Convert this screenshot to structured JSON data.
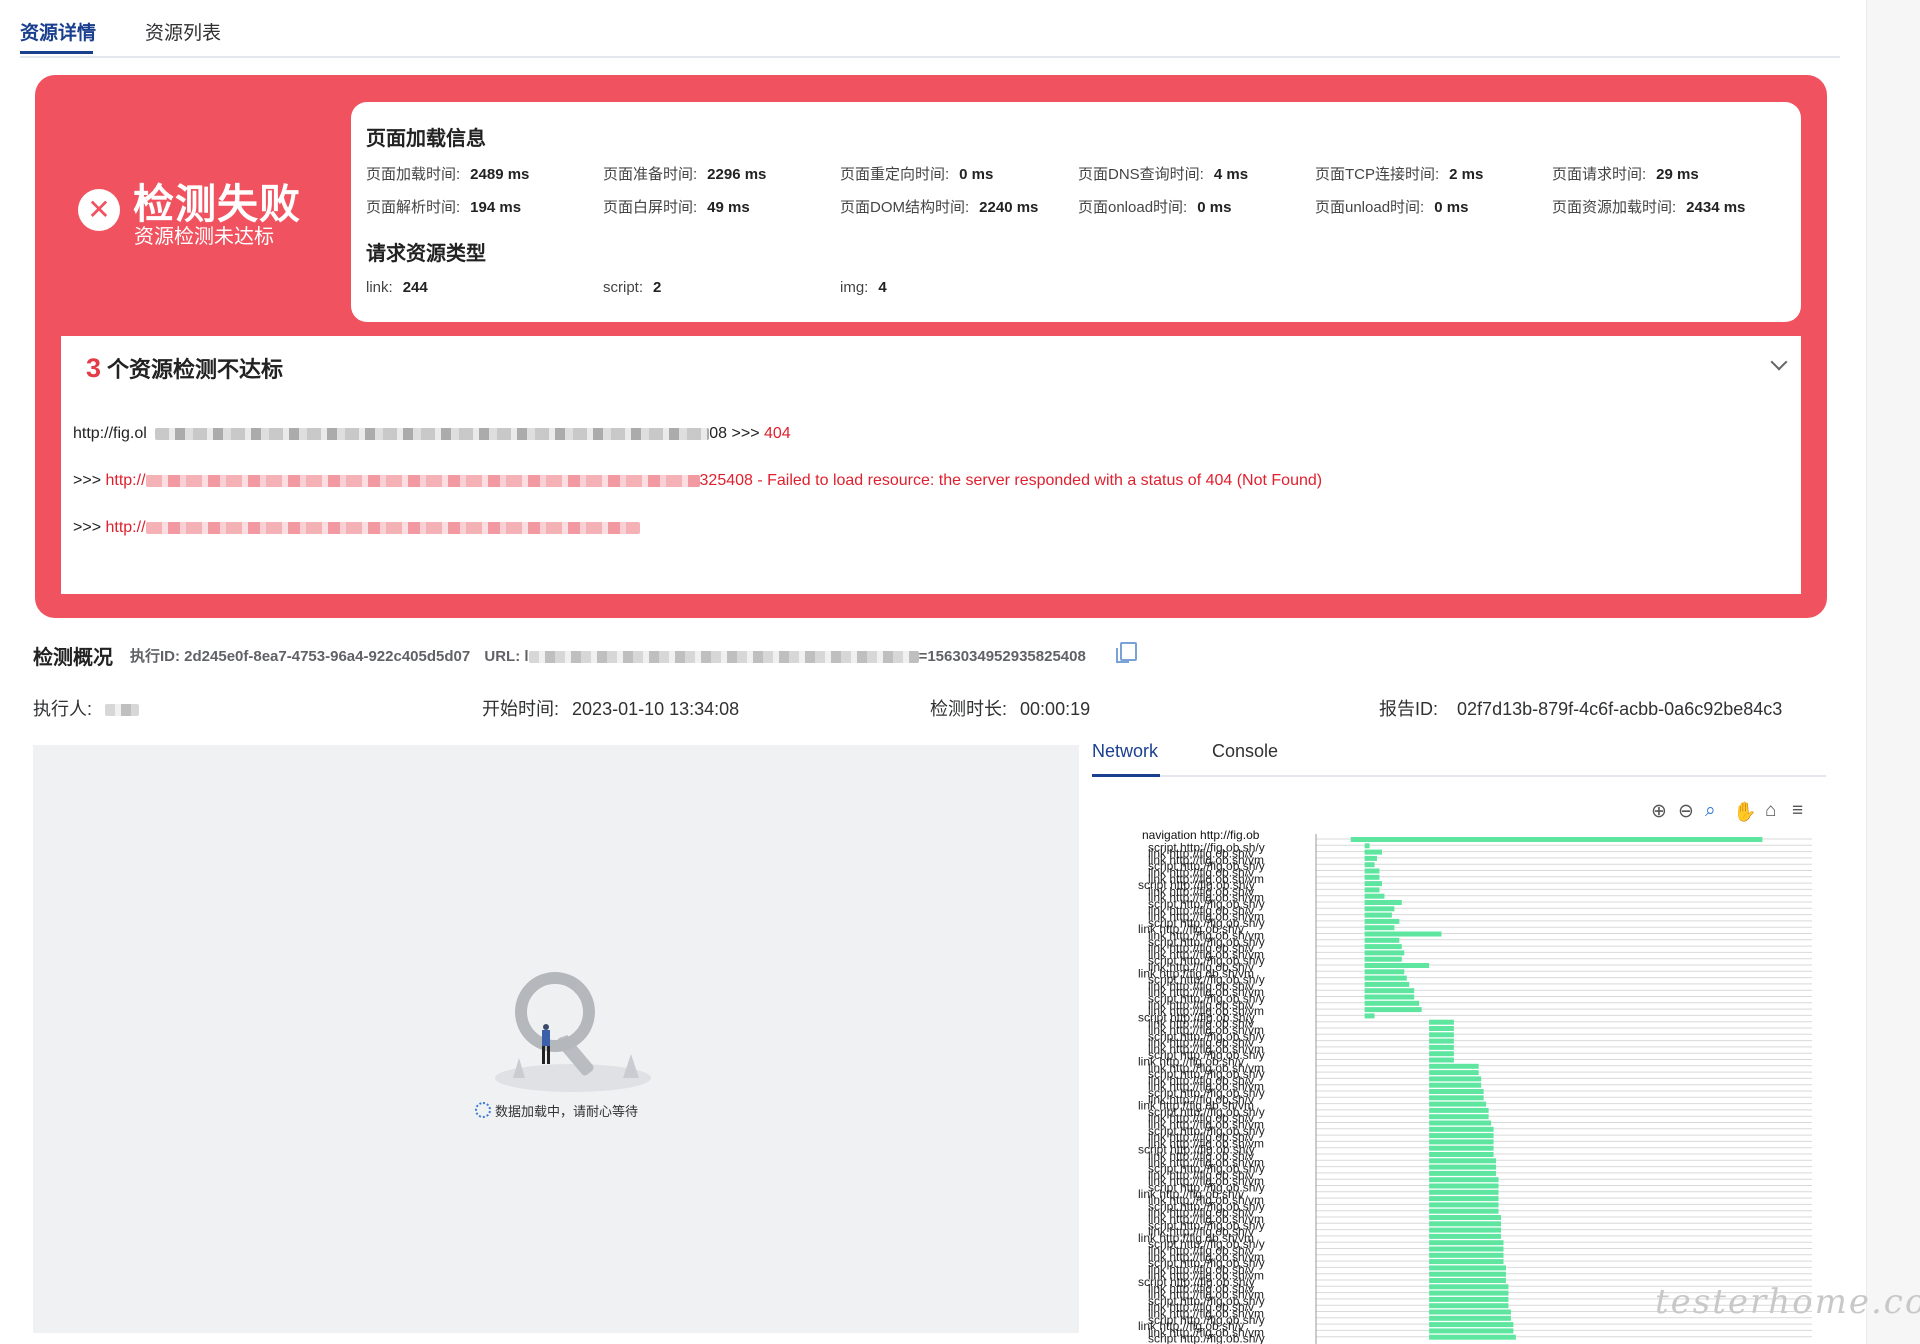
{
  "tabs": {
    "detail": "资源详情",
    "list": "资源列表"
  },
  "fail_banner": {
    "icon": "close-icon",
    "title": "检测失败",
    "subtitle": "资源检测未达标"
  },
  "load_info": {
    "title": "页面加载信息",
    "metrics": [
      {
        "label": "页面加载时间:",
        "value": "2489 ms"
      },
      {
        "label": "页面准备时间:",
        "value": "2296 ms"
      },
      {
        "label": "页面重定向时间:",
        "value": "0 ms"
      },
      {
        "label": "页面DNS查询时间:",
        "value": "4 ms"
      },
      {
        "label": "页面TCP连接时间:",
        "value": "2 ms"
      },
      {
        "label": "页面请求时间:",
        "value": "29 ms"
      },
      {
        "label": "页面解析时间:",
        "value": "194 ms"
      },
      {
        "label": "页面白屏时间:",
        "value": "49 ms"
      },
      {
        "label": "页面DOM结构时间:",
        "value": "2240 ms"
      },
      {
        "label": "页面onload时间:",
        "value": "0 ms"
      },
      {
        "label": "页面unload时间:",
        "value": "0 ms"
      },
      {
        "label": "页面资源加载时间:",
        "value": "2434 ms"
      }
    ]
  },
  "resource_types": {
    "title": "请求资源类型",
    "items": [
      {
        "label": "link:",
        "value": "244"
      },
      {
        "label": "script:",
        "value": "2"
      },
      {
        "label": "img:",
        "value": "4"
      }
    ]
  },
  "failed": {
    "count": "3",
    "label": "个资源检测不达标",
    "lines": [
      {
        "prefix": "http://fig.ol",
        "suffix": "08 >>> ",
        "code": "404"
      },
      {
        "prefix": ">>> ",
        "link": "http://",
        "message": "325408 - Failed to load resource: the server responded with a status of 404 (Not Found)"
      },
      {
        "prefix": ">>> ",
        "link": "http://"
      }
    ]
  },
  "overview": {
    "title": "检测概况",
    "exec_id": "执行ID: 2d245e0f-8ea7-4753-96a4-922c405d5d07",
    "url_label": "URL: l",
    "url_tail": "=1563034952935825408",
    "executor_label": "执行人:",
    "start_label": "开始时间:",
    "start_value": "2023-01-10 13:34:08",
    "duration_label": "检测时长:",
    "duration_value": "00:00:19",
    "report_label": "报告ID:",
    "report_value": "02f7d13b-879f-4c6f-acbb-0a6c92be84c3"
  },
  "loading": {
    "text": "数据加载中，请耐心等待"
  },
  "network_tabs": {
    "network": "Network",
    "console": "Console"
  },
  "toolbar_icons": [
    "zoom-in-icon",
    "zoom-out-icon",
    "magnify-icon",
    "pan-hand-icon",
    "home-icon",
    "menu-icon"
  ],
  "colors": {
    "fail_red": "#f0535f",
    "bar_green": "#5ee6a0",
    "accent_blue": "#1a3f8f",
    "error_red": "#e0202e"
  },
  "chart_data": {
    "type": "bar",
    "orientation": "horizontal",
    "first_label": "navigation http://fig.ob",
    "row_labels": [
      "link http://fig.ob.sh/vm",
      "script http://fig.ob.sh/y",
      "link http://fig.ob.sh/v"
    ],
    "bars_note": "waterfall start/duration per request (relative)",
    "bars": [
      {
        "start": 0.07,
        "length": 0.83
      },
      {
        "start": 0.098,
        "length": 0.01
      },
      {
        "start": 0.098,
        "length": 0.035
      },
      {
        "start": 0.098,
        "length": 0.025
      },
      {
        "start": 0.098,
        "length": 0.02
      },
      {
        "start": 0.098,
        "length": 0.03
      },
      {
        "start": 0.098,
        "length": 0.03
      },
      {
        "start": 0.098,
        "length": 0.035
      },
      {
        "start": 0.098,
        "length": 0.03
      },
      {
        "start": 0.098,
        "length": 0.04
      },
      {
        "start": 0.098,
        "length": 0.075
      },
      {
        "start": 0.098,
        "length": 0.06
      },
      {
        "start": 0.098,
        "length": 0.055
      },
      {
        "start": 0.098,
        "length": 0.07
      },
      {
        "start": 0.098,
        "length": 0.06
      },
      {
        "start": 0.098,
        "length": 0.155
      },
      {
        "start": 0.098,
        "length": 0.07
      },
      {
        "start": 0.098,
        "length": 0.075
      },
      {
        "start": 0.098,
        "length": 0.08
      },
      {
        "start": 0.098,
        "length": 0.075
      },
      {
        "start": 0.098,
        "length": 0.13
      },
      {
        "start": 0.098,
        "length": 0.08
      },
      {
        "start": 0.098,
        "length": 0.085
      },
      {
        "start": 0.098,
        "length": 0.09
      },
      {
        "start": 0.098,
        "length": 0.1
      },
      {
        "start": 0.098,
        "length": 0.1
      },
      {
        "start": 0.098,
        "length": 0.11
      },
      {
        "start": 0.098,
        "length": 0.115
      },
      {
        "start": 0.098,
        "length": 0.02
      },
      {
        "start": 0.228,
        "length": 0.05
      },
      {
        "start": 0.228,
        "length": 0.05
      },
      {
        "start": 0.228,
        "length": 0.05
      },
      {
        "start": 0.228,
        "length": 0.05
      },
      {
        "start": 0.228,
        "length": 0.05
      },
      {
        "start": 0.228,
        "length": 0.05
      },
      {
        "start": 0.228,
        "length": 0.05
      },
      {
        "start": 0.228,
        "length": 0.1
      },
      {
        "start": 0.228,
        "length": 0.1
      },
      {
        "start": 0.228,
        "length": 0.105
      },
      {
        "start": 0.228,
        "length": 0.105
      },
      {
        "start": 0.228,
        "length": 0.11
      },
      {
        "start": 0.228,
        "length": 0.11
      },
      {
        "start": 0.228,
        "length": 0.115
      },
      {
        "start": 0.228,
        "length": 0.12
      },
      {
        "start": 0.228,
        "length": 0.12
      },
      {
        "start": 0.228,
        "length": 0.125
      },
      {
        "start": 0.228,
        "length": 0.13
      },
      {
        "start": 0.228,
        "length": 0.13
      },
      {
        "start": 0.228,
        "length": 0.13
      },
      {
        "start": 0.228,
        "length": 0.13
      },
      {
        "start": 0.228,
        "length": 0.13
      },
      {
        "start": 0.228,
        "length": 0.135
      },
      {
        "start": 0.228,
        "length": 0.135
      },
      {
        "start": 0.228,
        "length": 0.135
      },
      {
        "start": 0.228,
        "length": 0.14
      },
      {
        "start": 0.228,
        "length": 0.14
      },
      {
        "start": 0.228,
        "length": 0.14
      },
      {
        "start": 0.228,
        "length": 0.14
      },
      {
        "start": 0.228,
        "length": 0.14
      },
      {
        "start": 0.228,
        "length": 0.14
      },
      {
        "start": 0.228,
        "length": 0.145
      },
      {
        "start": 0.228,
        "length": 0.145
      },
      {
        "start": 0.228,
        "length": 0.145
      },
      {
        "start": 0.228,
        "length": 0.145
      },
      {
        "start": 0.228,
        "length": 0.15
      },
      {
        "start": 0.228,
        "length": 0.15
      },
      {
        "start": 0.228,
        "length": 0.15
      },
      {
        "start": 0.228,
        "length": 0.15
      },
      {
        "start": 0.228,
        "length": 0.155
      },
      {
        "start": 0.228,
        "length": 0.155
      },
      {
        "start": 0.228,
        "length": 0.155
      },
      {
        "start": 0.228,
        "length": 0.16
      },
      {
        "start": 0.228,
        "length": 0.16
      },
      {
        "start": 0.228,
        "length": 0.16
      },
      {
        "start": 0.228,
        "length": 0.16
      },
      {
        "start": 0.228,
        "length": 0.165
      },
      {
        "start": 0.228,
        "length": 0.165
      },
      {
        "start": 0.228,
        "length": 0.17
      },
      {
        "start": 0.228,
        "length": 0.17
      },
      {
        "start": 0.228,
        "length": 0.175
      }
    ]
  },
  "watermark": "testerhome.com"
}
